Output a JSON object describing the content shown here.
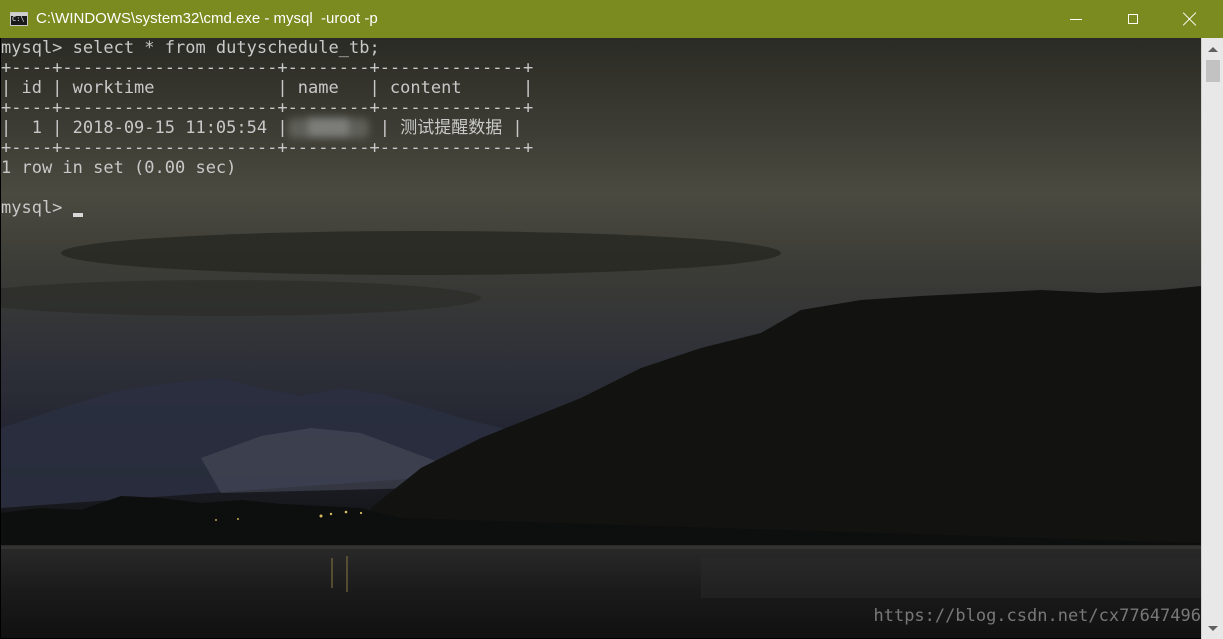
{
  "window": {
    "title": "C:\\WINDOWS\\system32\\cmd.exe - mysql  -uroot -p",
    "icon": "cmd-icon",
    "accent_color": "#7b8b1f"
  },
  "terminal": {
    "lines": [
      "mysql> select * from dutyschedule_tb;",
      "+----+---------------------+--------+--------------+",
      "| id | worktime            | name   | content      |",
      "+----+---------------------+--------+--------------+",
      "|  1 | 2018-09-15 11:05:54 |",
      "+----+---------------------+--------+--------------+",
      "1 row in set (0.00 sec)",
      "",
      "mysql> "
    ],
    "row_content": " 测试提醒数据 |",
    "row_name_redacted": "  ▒▒▒▒  ",
    "row_sep": " |",
    "text_color": "#c8c8c8"
  },
  "watermark": "https://blog.csdn.net/cx77647496"
}
